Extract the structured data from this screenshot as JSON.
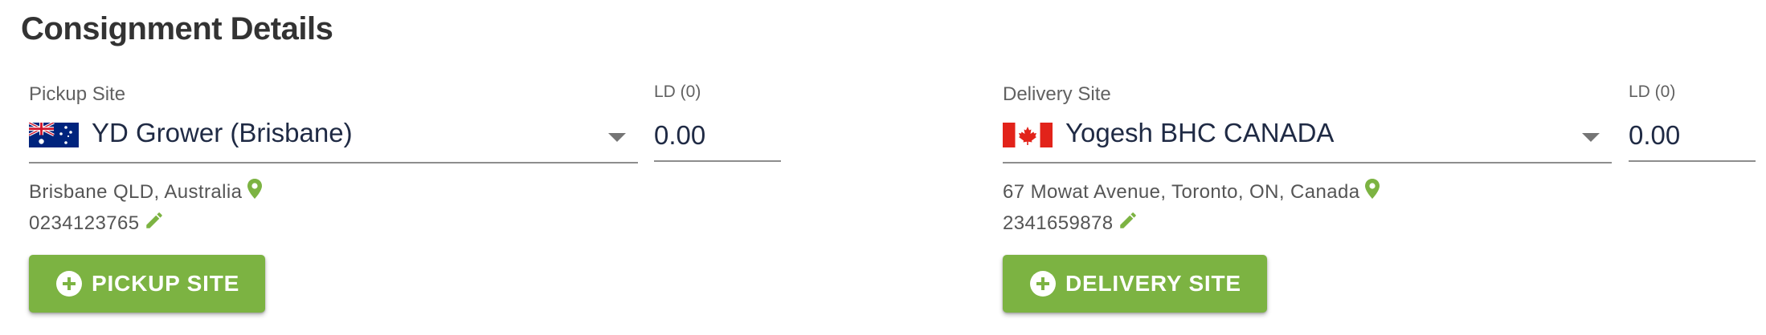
{
  "section": {
    "title": "Consignment Details"
  },
  "pickup": {
    "site_label": "Pickup Site",
    "site_value": "YD Grower (Brisbane)",
    "country_flag": "australia-flag",
    "ld_label": "LD (0)",
    "ld_value": "0.00",
    "address": "Brisbane QLD, Australia",
    "phone": "0234123765",
    "add_button_label": "PICKUP SITE"
  },
  "delivery": {
    "site_label": "Delivery Site",
    "site_value": "Yogesh BHC CANADA",
    "country_flag": "canada-flag",
    "ld_label": "LD (0)",
    "ld_value": "0.00",
    "address": "67 Mowat Avenue, Toronto, ON, Canada",
    "phone": "2341659878",
    "add_button_label": "DELIVERY SITE"
  },
  "icons": {
    "location": "map-pin-icon",
    "edit": "pencil-icon",
    "add": "plus-circle-icon",
    "dropdown": "caret-down-icon"
  },
  "colors": {
    "accent_green": "#7cb342",
    "text_dark": "#1f2a44",
    "label_gray": "#616161"
  }
}
